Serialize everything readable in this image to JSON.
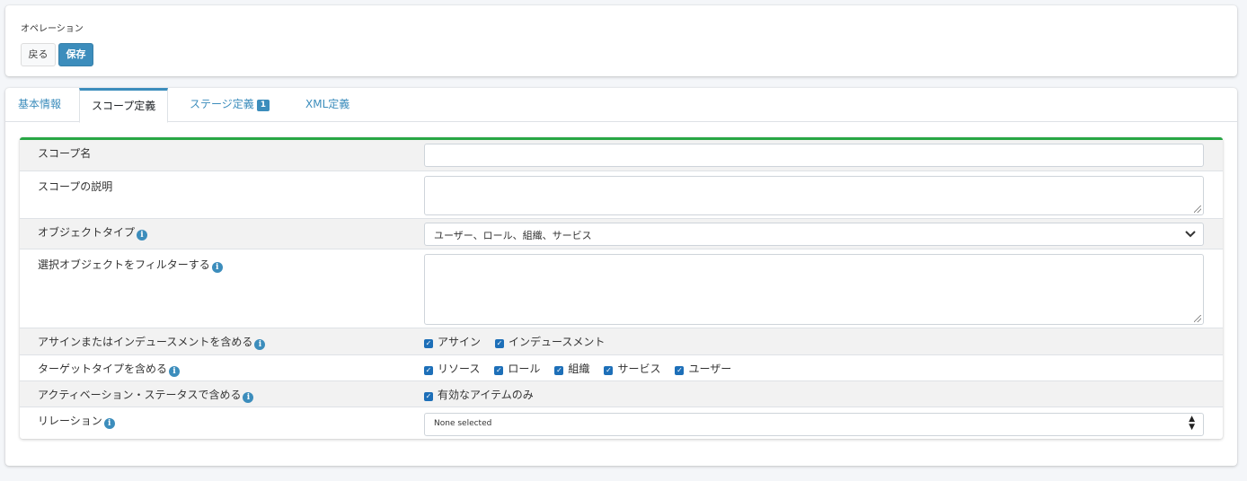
{
  "operations": {
    "title": "オペレーション",
    "back_label": "戻る",
    "save_label": "保存"
  },
  "tabs": [
    {
      "label": "基本情報"
    },
    {
      "label": "スコープ定義"
    },
    {
      "label": "ステージ定義",
      "badge": "1"
    },
    {
      "label": "XML定義"
    }
  ],
  "form": {
    "scope_name": {
      "label": "スコープ名",
      "value": ""
    },
    "scope_desc": {
      "label": "スコープの説明",
      "value": ""
    },
    "object_type": {
      "label": "オブジェクトタイプ",
      "value": "ユーザー、ロール、組織、サービス"
    },
    "filter": {
      "label": "選択オブジェクトをフィルターする",
      "value": ""
    },
    "assign": {
      "label": "アサインまたはインデュースメントを含める",
      "options": [
        {
          "label": "アサイン",
          "checked": true
        },
        {
          "label": "インデュースメント",
          "checked": true
        }
      ]
    },
    "target_type": {
      "label": "ターゲットタイプを含める",
      "options": [
        {
          "label": "リソース",
          "checked": true
        },
        {
          "label": "ロール",
          "checked": true
        },
        {
          "label": "組織",
          "checked": true
        },
        {
          "label": "サービス",
          "checked": true
        },
        {
          "label": "ユーザー",
          "checked": true
        }
      ]
    },
    "activation": {
      "label": "アクティベーション・ステータスで含める",
      "options": [
        {
          "label": "有効なアイテムのみ",
          "checked": true
        }
      ]
    },
    "relation": {
      "label": "リレーション",
      "value": "None selected"
    }
  },
  "colors": {
    "primary": "#3c8dbc",
    "success_border": "#28a745",
    "checkbox": "#1d6fb8"
  }
}
